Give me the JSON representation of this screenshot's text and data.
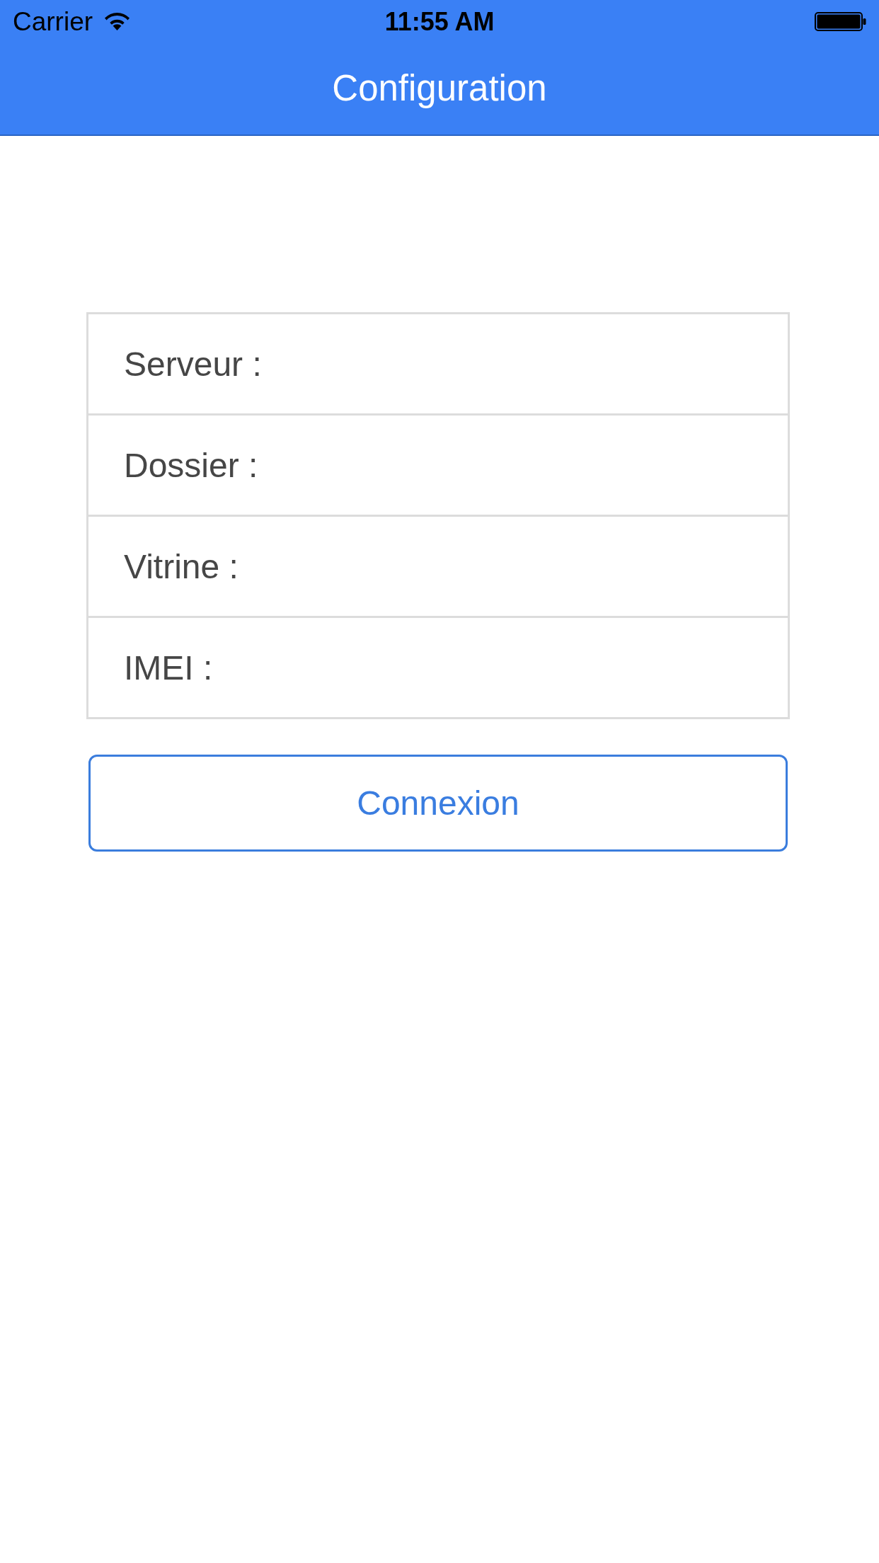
{
  "status_bar": {
    "carrier": "Carrier",
    "time": "11:55 AM"
  },
  "nav_bar": {
    "title": "Configuration"
  },
  "form": {
    "fields": [
      {
        "label": "Serveur :"
      },
      {
        "label": "Dossier :"
      },
      {
        "label": "Vitrine :"
      },
      {
        "label": "IMEI :"
      }
    ]
  },
  "button": {
    "label": "Connexion"
  }
}
